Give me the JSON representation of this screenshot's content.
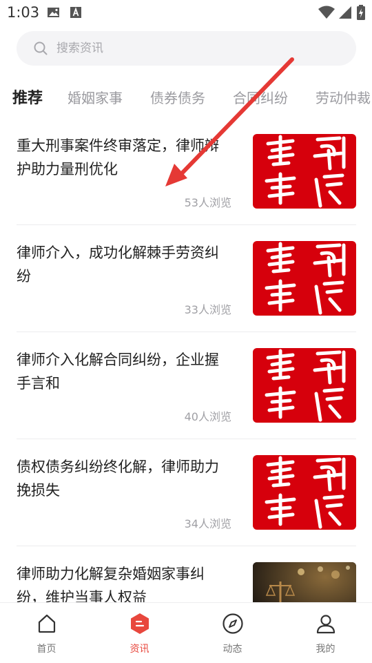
{
  "status_bar": {
    "time": "1:03",
    "icons": [
      "image-icon",
      "a-notification-icon",
      "wifi-icon",
      "signal-icon",
      "battery-charging-icon"
    ]
  },
  "search": {
    "placeholder": "搜索资讯"
  },
  "tabs": [
    {
      "label": "推荐",
      "active": true
    },
    {
      "label": "婚姻家事",
      "active": false
    },
    {
      "label": "债券债务",
      "active": false
    },
    {
      "label": "合同纠纷",
      "active": false
    },
    {
      "label": "劳动仲裁",
      "active": false
    }
  ],
  "articles": [
    {
      "title": "重大刑事案件终审落定，律师辩护助力量刑优化",
      "views": "53人浏览",
      "thumb": "red-calligraphy"
    },
    {
      "title": "律师介入，成功化解棘手劳资纠纷",
      "views": "33人浏览",
      "thumb": "red-calligraphy"
    },
    {
      "title": "律师介入化解合同纠纷，企业握手言和",
      "views": "40人浏览",
      "thumb": "red-calligraphy"
    },
    {
      "title": "债权债务纠纷终化解，律师助力挽损失",
      "views": "34人浏览",
      "thumb": "red-calligraphy"
    },
    {
      "title": "律师助力化解复杂婚姻家事纠纷，维护当事人权益",
      "views": "",
      "thumb": "scales-photo"
    }
  ],
  "bottom_nav": [
    {
      "label": "首页",
      "icon": "home-icon",
      "active": false
    },
    {
      "label": "资讯",
      "icon": "news-icon",
      "active": true
    },
    {
      "label": "动态",
      "icon": "compass-icon",
      "active": false
    },
    {
      "label": "我的",
      "icon": "profile-icon",
      "active": false
    }
  ],
  "colors": {
    "accent": "#e8473d",
    "thumb_red": "#d6000c",
    "annotation_red": "#e53935"
  }
}
